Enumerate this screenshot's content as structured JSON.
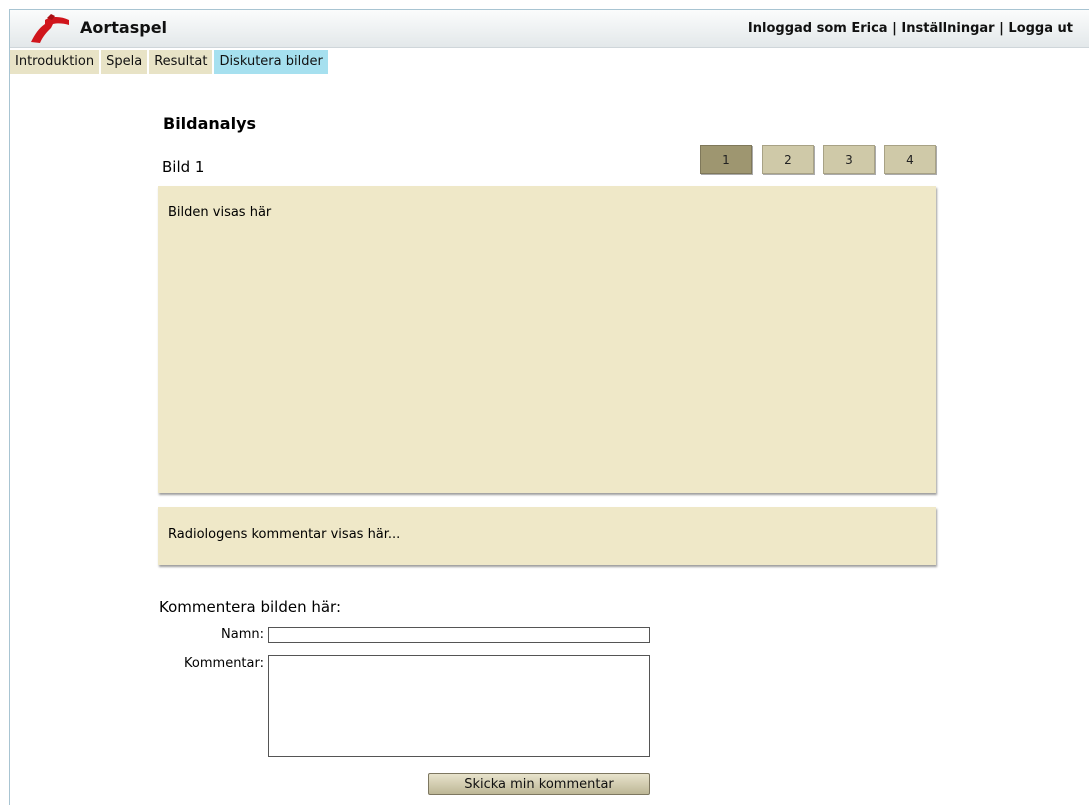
{
  "header": {
    "app_title": "Aortaspel",
    "user_nav": {
      "logged_in": "Inloggad som Erica",
      "separator": " | ",
      "settings": "Inställningar",
      "logout": "Logga ut"
    }
  },
  "tabs": [
    {
      "label": "Introduktion",
      "active": false
    },
    {
      "label": "Spela",
      "active": false
    },
    {
      "label": "Resultat",
      "active": false
    },
    {
      "label": "Diskutera bilder",
      "active": true
    }
  ],
  "main": {
    "section_title": "Bildanalys",
    "image_label": "Bild 1",
    "pager": [
      "1",
      "2",
      "3",
      "4"
    ],
    "pager_selected": "1",
    "image_placeholder": "Bilden visas här",
    "radiologist_comment": "Radiologens kommentar visas här..."
  },
  "form": {
    "heading": "Kommentera bilden här:",
    "name_label": "Namn:",
    "name_value": "",
    "comment_label": "Kommentar:",
    "comment_value": "",
    "submit_label": "Skicka min kommentar"
  },
  "colors": {
    "tab_background": "#e8e3c6",
    "tab_active": "#a6e0ef",
    "panel_background": "#efe8c8",
    "pager_active": "#9e9670",
    "logo_red": "#d0151c"
  },
  "icons": {
    "logo": "aorta-logo-icon"
  }
}
